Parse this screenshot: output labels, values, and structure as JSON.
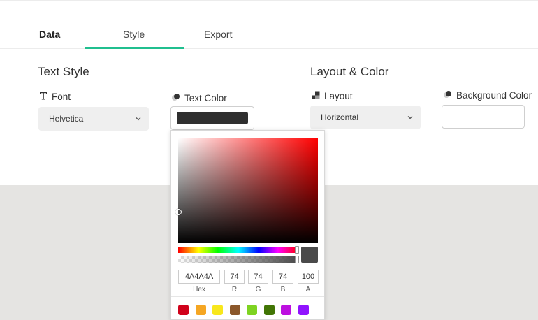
{
  "tabs": [
    {
      "label": "Data"
    },
    {
      "label": "Style"
    },
    {
      "label": "Export"
    }
  ],
  "text_style": {
    "title": "Text Style",
    "font_label": "Font",
    "font_value": "Helvetica",
    "text_color_label": "Text Color",
    "text_color": "#2f2f2f"
  },
  "layout_color": {
    "title": "Layout & Color",
    "layout_label": "Layout",
    "layout_value": "Horizontal",
    "background_color_label": "Background Color"
  },
  "picker": {
    "hex": "4A4A4A",
    "r": "74",
    "g": "74",
    "b": "74",
    "a": "100",
    "labels": {
      "hex": "Hex",
      "r": "R",
      "g": "G",
      "b": "B",
      "a": "A"
    },
    "preview_color": "#4a4a4a",
    "hue_color": "#ff0000",
    "swatches": [
      "#d0021b",
      "#f5a623",
      "#f8e71c",
      "#8b572a",
      "#7ed321",
      "#417505",
      "#bd10e0",
      "#9013fe"
    ]
  },
  "colors": {
    "accent": "#20bf8f"
  }
}
